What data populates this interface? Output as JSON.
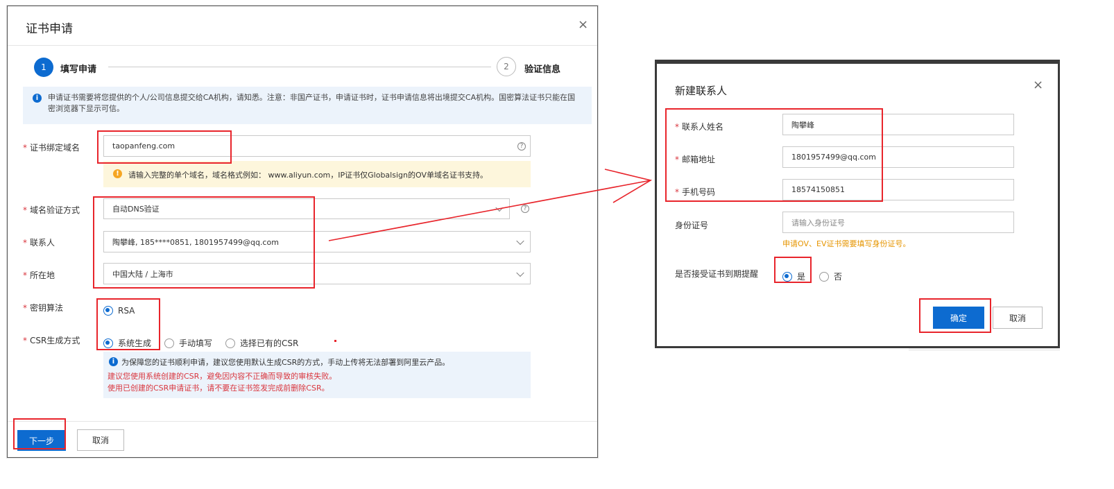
{
  "left_dialog": {
    "title": "证书申请",
    "close_icon": "×",
    "steps": [
      {
        "number": "1",
        "label": "填写申请"
      },
      {
        "number": "2",
        "label": "验证信息"
      }
    ],
    "notice": "申请证书需要将您提供的个人/公司信息提交给CA机构，请知悉。注意：非国产证书，申请证书时，证书申请信息将出境提交CA机构。国密算法证书只能在国密浏览器下显示可信。",
    "domain": {
      "label": "证书绑定域名",
      "value": "taopanfeng.com",
      "help_icon": "?",
      "hint": "请输入完整的单个域名，域名格式例如： www.aliyun.com，IP证书仅Globalsign的OV单域名证书支持。"
    },
    "verify_method": {
      "label": "域名验证方式",
      "value": "自动DNS验证"
    },
    "contact": {
      "label": "联系人",
      "value": "陶攀峰, 185****0851, 1801957499@qq.com"
    },
    "location": {
      "label": "所在地",
      "value": "中国大陆 / 上海市"
    },
    "key_algo": {
      "label": "密钥算法",
      "option": "RSA"
    },
    "csr": {
      "label": "CSR生成方式",
      "options": [
        "系统生成",
        "手动填写",
        "选择已有的CSR"
      ],
      "info": "为保障您的证书顺利申请，建议您使用默认生成CSR的方式，手动上传将无法部署到阿里云产品。",
      "warn1": "建议您使用系统创建的CSR，避免因内容不正确而导致的审核失败。",
      "warn2": "使用已创建的CSR申请证书，请不要在证书签发完成前删除CSR。"
    },
    "next_button": "下一步",
    "cancel_button": "取消"
  },
  "right_dialog": {
    "title": "新建联系人",
    "close_icon": "×",
    "name": {
      "label": "联系人姓名",
      "value": "陶攀峰"
    },
    "email": {
      "label": "邮箱地址",
      "value": "1801957499@qq.com"
    },
    "phone": {
      "label": "手机号码",
      "value": "18574150851"
    },
    "id_card": {
      "label": "身份证号",
      "placeholder": "请输入身份证号",
      "hint": "申请OV、EV证书需要填写身份证号。"
    },
    "reminder": {
      "label": "是否接受证书到期提醒",
      "yes": "是",
      "no": "否"
    },
    "ok_button": "确定",
    "cancel_button": "取消"
  },
  "colors": {
    "primary": "#0d6bd0",
    "annotation_red": "#e8242b",
    "hint_orange": "#e69500"
  }
}
